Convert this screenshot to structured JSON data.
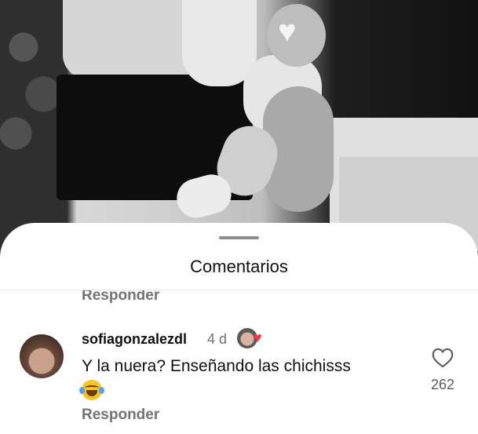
{
  "sheet": {
    "title": "Comentarios"
  },
  "previous_comment": {
    "reply_label": "Responder"
  },
  "comment": {
    "username": "sofiagonzalezdl",
    "time": "4 d",
    "text": "Y la nuera? Enseñando las chichisss",
    "emoji": "face-with-tears-of-joy",
    "reply_label": "Responder",
    "like_count": "262",
    "author_liked": true
  },
  "colors": {
    "heart_red": "#ff3040",
    "secondary_text": "#737373"
  }
}
